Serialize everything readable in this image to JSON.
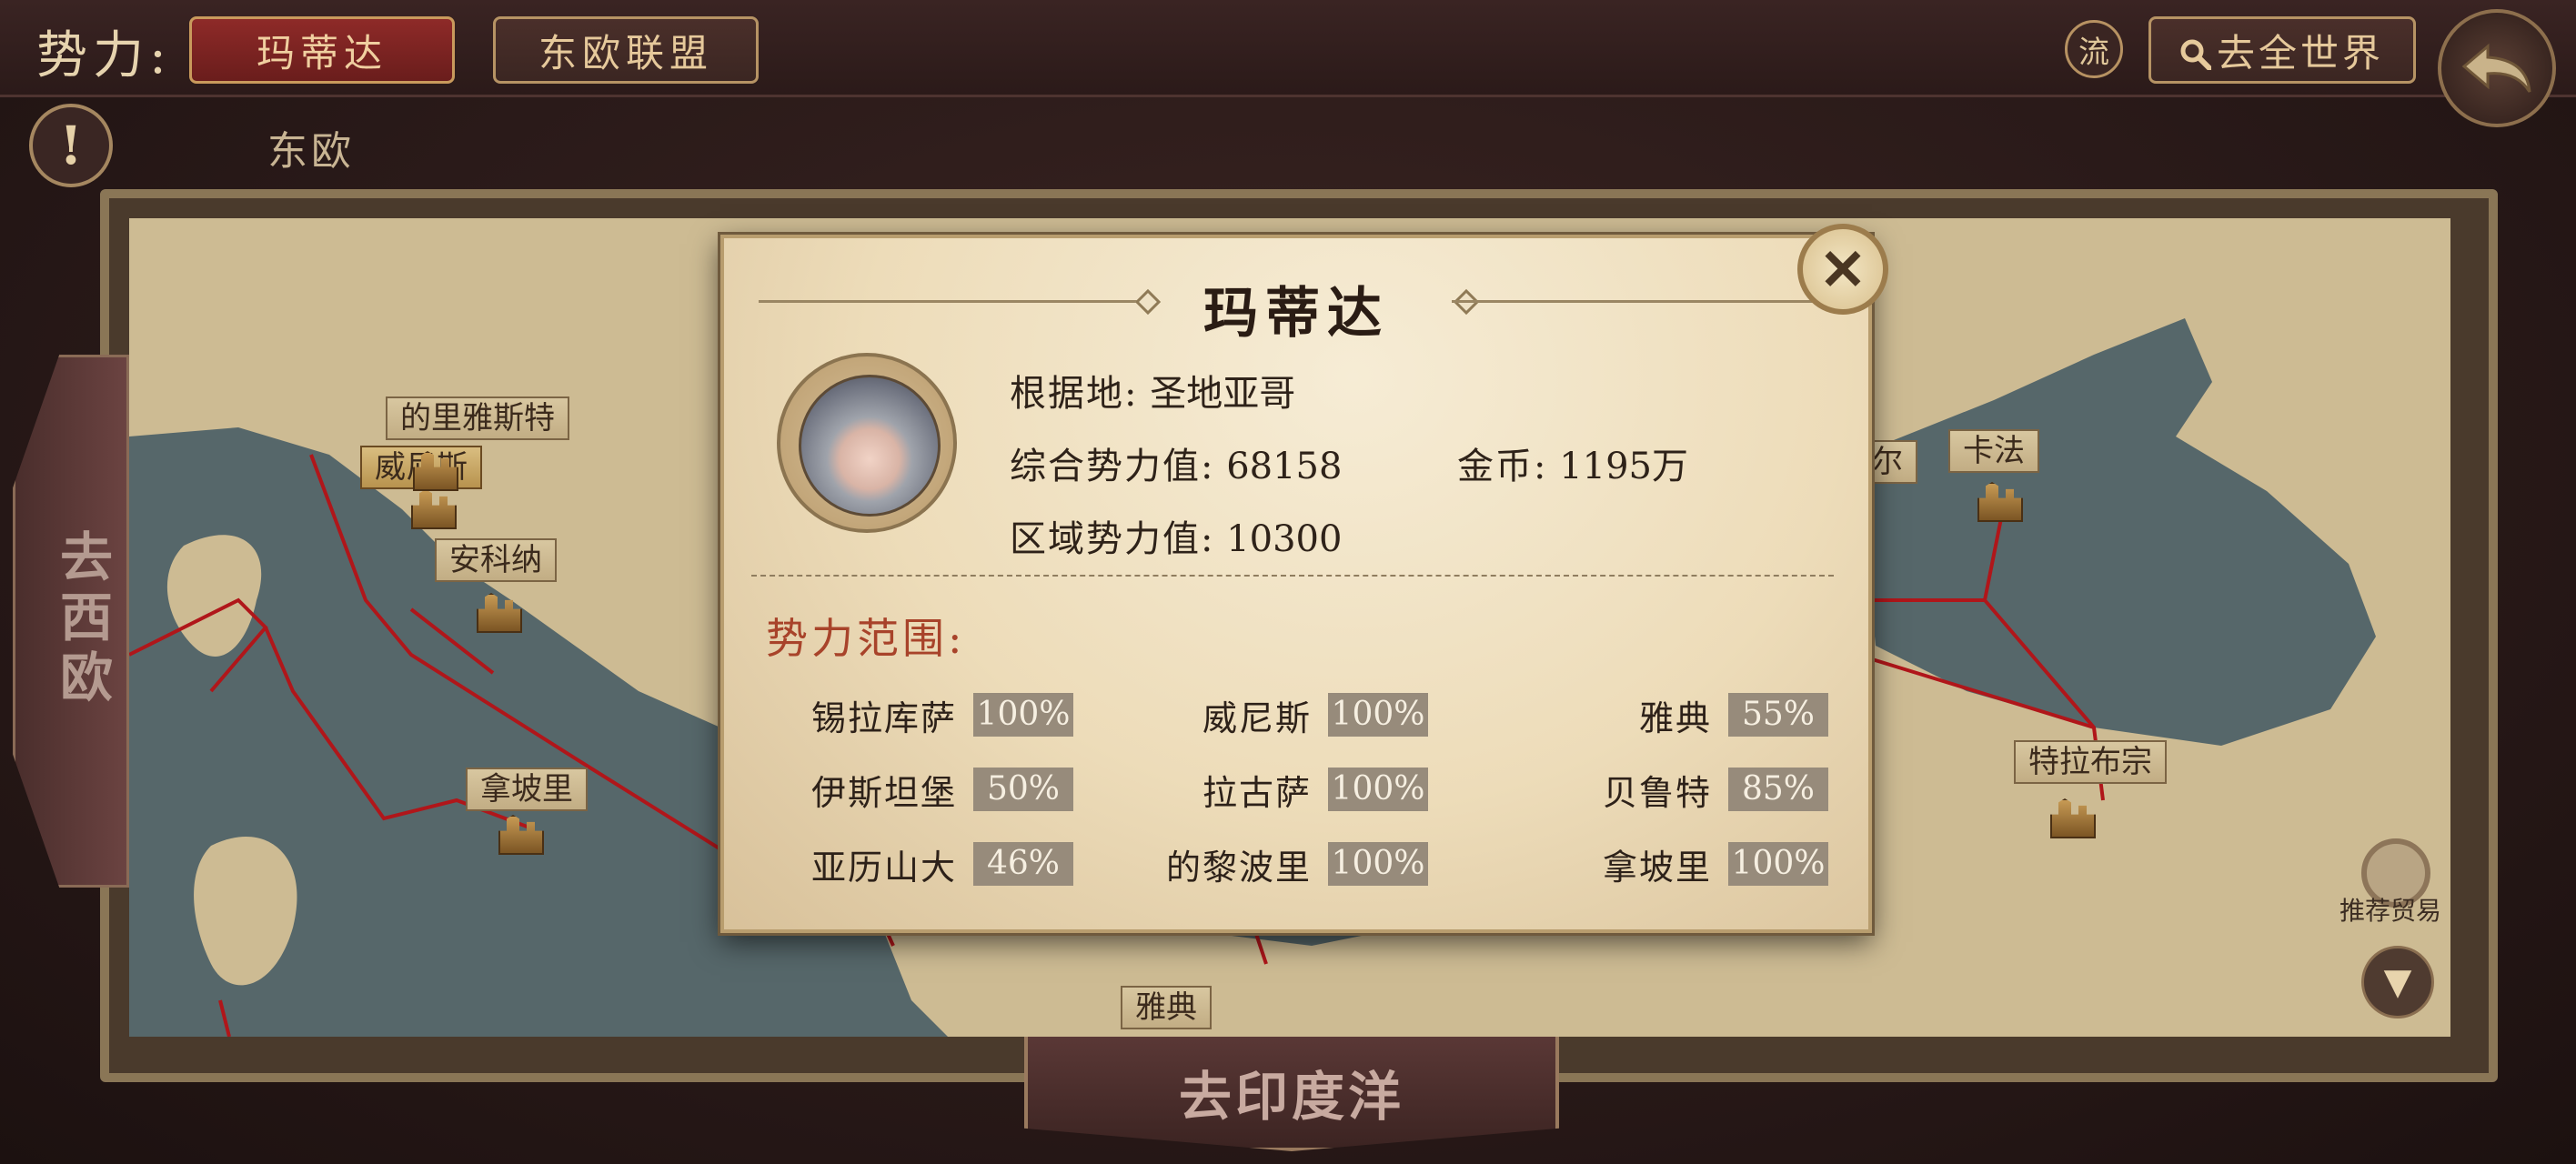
{
  "header": {
    "faction_label": "势力:",
    "active_tab": "玛蒂达",
    "other_tab": "东欧联盟",
    "liu_button": "流",
    "world_button": "去全世界"
  },
  "region_name": "东欧",
  "map": {
    "labels": [
      "的里雅斯特",
      "威尼斯",
      "安科纳",
      "拿坡里",
      "雅典",
      "卡法",
      "特拉布宗",
      "尔"
    ],
    "west_label": "去西欧",
    "south_label": "去印度洋",
    "trade_label": "推荐贸易"
  },
  "popup": {
    "title": "玛蒂达",
    "base_label": "根据地:",
    "base_value": "圣地亚哥",
    "power_label": "综合势力值:",
    "power_value": "68158",
    "gold_label": "金币:",
    "gold_value": "1195万",
    "region_power_label": "区域势力值:",
    "region_power_value": "10300",
    "scope_title": "势力范围:",
    "scope": [
      {
        "name": "锡拉库萨",
        "percent": "100%"
      },
      {
        "name": "威尼斯",
        "percent": "100%"
      },
      {
        "name": "雅典",
        "percent": "55%"
      },
      {
        "name": "伊斯坦堡",
        "percent": "50%"
      },
      {
        "name": "拉古萨",
        "percent": "100%"
      },
      {
        "name": "贝鲁特",
        "percent": "85%"
      },
      {
        "name": "亚历山大",
        "percent": "46%"
      },
      {
        "name": "的黎波里",
        "percent": "100%"
      },
      {
        "name": "拿坡里",
        "percent": "100%"
      }
    ]
  },
  "icons": [
    "search-icon",
    "back-arrow-icon",
    "exclamation-icon",
    "close-icon",
    "trade-icon",
    "down-arrow-icon",
    "castle-icon"
  ]
}
